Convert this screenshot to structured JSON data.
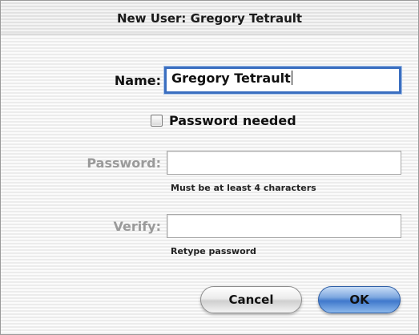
{
  "dialog": {
    "title": "New User: Gregory Tetrault"
  },
  "form": {
    "name_label": "Name:",
    "name_value": "Gregory Tetrault",
    "password_needed_label": "Password needed",
    "password_needed_checked": false,
    "password_label": "Password:",
    "password_value": "",
    "password_hint": "Must be at least 4 characters",
    "verify_label": "Verify:",
    "verify_value": "",
    "verify_hint": "Retype password"
  },
  "buttons": {
    "cancel_label": "Cancel",
    "ok_label": "OK"
  },
  "colors": {
    "focus_ring": "#3a6ec0",
    "default_button": "#3f78cc",
    "disabled_label": "#9a9a9a"
  }
}
